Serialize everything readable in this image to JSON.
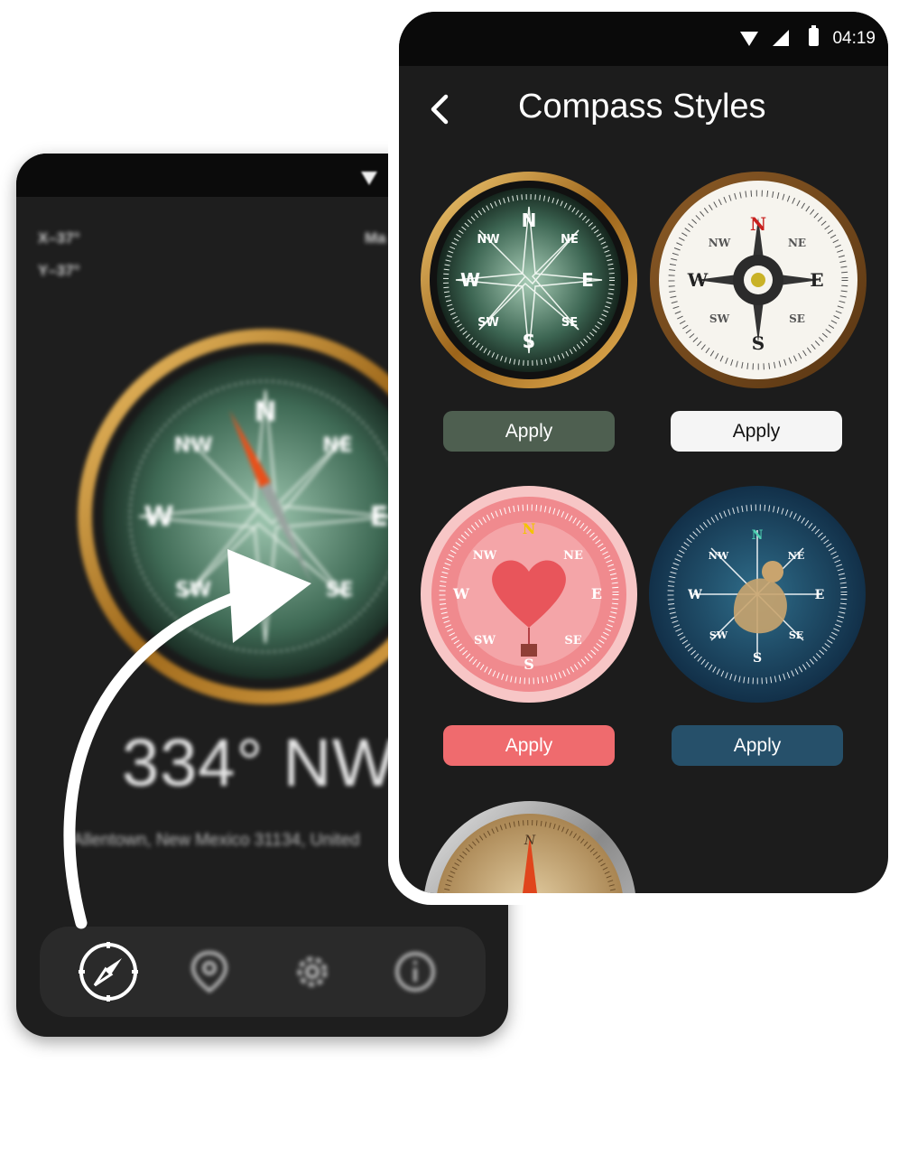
{
  "back_screen": {
    "coord_x": "X–37°",
    "coord_y": "Y–37°",
    "magnetic_label": "Ma",
    "heading": "334° NW",
    "address": "Allentown, New Mexico 31134, United",
    "nav": [
      {
        "icon": "compass-icon",
        "active": true
      },
      {
        "icon": "location-pin-icon",
        "active": false
      },
      {
        "icon": "gear-icon",
        "active": false
      },
      {
        "icon": "info-icon",
        "active": false
      }
    ]
  },
  "status_bar": {
    "time": "04:19"
  },
  "header": {
    "title": "Compass Styles",
    "back_icon": "chevron-left-icon"
  },
  "styles": [
    {
      "name": "emerald-brass",
      "apply_label": "Apply",
      "button_color": "#4e5f50"
    },
    {
      "name": "classic-white",
      "apply_label": "Apply",
      "button_color": "#f5f5f5"
    },
    {
      "name": "pink-heart",
      "apply_label": "Apply",
      "button_color": "#ef6b6e"
    },
    {
      "name": "navy-cupid",
      "apply_label": "Apply",
      "button_color": "#26506a"
    },
    {
      "name": "vintage-steel",
      "apply_label": "Apply",
      "button_color": ""
    }
  ],
  "dial_letters": {
    "n": "N",
    "s": "S",
    "e": "E",
    "w": "W",
    "ne": "NE",
    "nw": "NW",
    "se": "SE",
    "sw": "SW"
  }
}
